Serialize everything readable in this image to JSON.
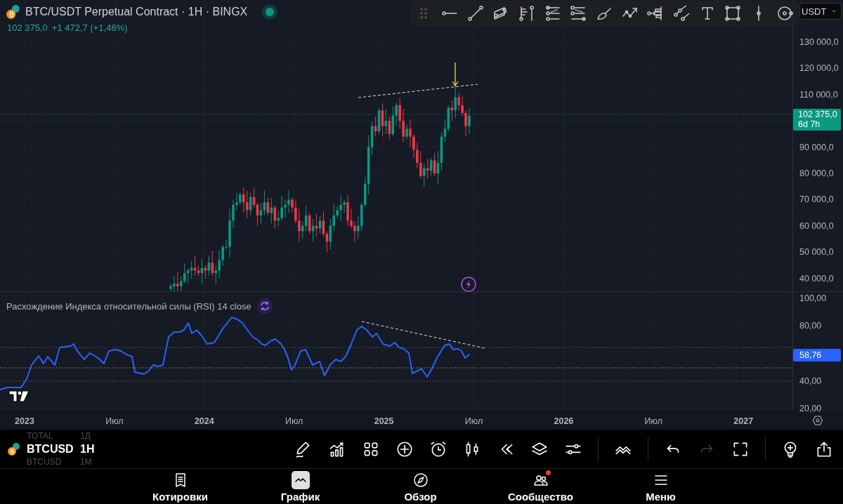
{
  "header": {
    "title": "BTC/USDT Perpetual Contract · 1H · BINGX",
    "market_open": true,
    "quote": "102 375,0",
    "change": "+1 472,7 (+1,46%)"
  },
  "currency_selector": {
    "value": "USDT"
  },
  "price_axis": {
    "ticks": [
      "130 000,0",
      "120 000,0",
      "110 000,0",
      "90 000,0",
      "80 000,0",
      "70 000,0",
      "60 000,0",
      "50 000,0",
      "40 000,0"
    ],
    "last_price": "102 375,0",
    "countdown": "6d 7h"
  },
  "indicator": {
    "title": "Расхождение Индекса относительной силы (RSI) 14 close",
    "ticks": [
      "100,00",
      "80,00",
      "40,00",
      "20,00"
    ],
    "value": "58,76"
  },
  "time_axis": [
    {
      "label": "2023",
      "kind": "year"
    },
    {
      "label": "Июл",
      "kind": "month"
    },
    {
      "label": "2024",
      "kind": "year"
    },
    {
      "label": "Июл",
      "kind": "month"
    },
    {
      "label": "2025",
      "kind": "year"
    },
    {
      "label": "Июл",
      "kind": "month"
    },
    {
      "label": "2026",
      "kind": "year"
    },
    {
      "label": "Июл",
      "kind": "month"
    },
    {
      "label": "2027",
      "kind": "year"
    }
  ],
  "symbol_picker": [
    {
      "symbol": "TOTAL",
      "interval": "1Д",
      "selected": false
    },
    {
      "symbol": "BTCUSD",
      "interval": "1H",
      "selected": true
    },
    {
      "symbol": "BTCUSD",
      "interval": "1M",
      "selected": false
    }
  ],
  "toolbar": {
    "redo": {
      "disabled": true
    }
  },
  "nav": [
    {
      "label": "Котировки",
      "selected": false,
      "notification": false
    },
    {
      "label": "График",
      "selected": true,
      "notification": false
    },
    {
      "label": "Обзор",
      "selected": false,
      "notification": false
    },
    {
      "label": "Сообщество",
      "selected": false,
      "notification": true
    },
    {
      "label": "Меню",
      "selected": false,
      "notification": false
    }
  ]
}
